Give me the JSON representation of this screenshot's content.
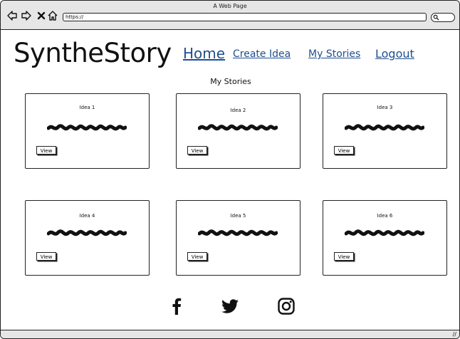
{
  "browser": {
    "title": "A Web Page",
    "url": "https://"
  },
  "header": {
    "logo": "SyntheStory",
    "nav": {
      "home": "Home",
      "create_idea": "Create Idea",
      "my_stories": "My Stories",
      "logout": "Logout"
    }
  },
  "main": {
    "section_title": "My Stories",
    "cards": [
      {
        "title": "Idea 1",
        "button": "View"
      },
      {
        "title": "Idea 2",
        "button": "View"
      },
      {
        "title": "Idea 3",
        "button": "View"
      },
      {
        "title": "Idea 4",
        "button": "View"
      },
      {
        "title": "Idea 5",
        "button": "View"
      },
      {
        "title": "Idea 6",
        "button": "View"
      }
    ]
  },
  "footer": {
    "social_icons": [
      "facebook-icon",
      "twitter-icon",
      "instagram-icon"
    ]
  },
  "colors": {
    "link": "#1f4f8f",
    "chrome": "#e6e6e6"
  }
}
